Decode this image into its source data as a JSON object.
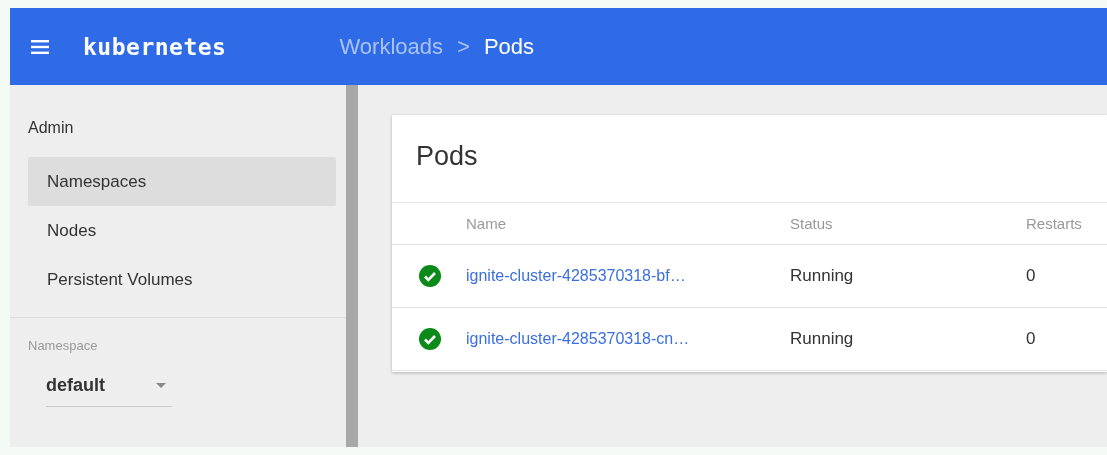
{
  "top_bar": {
    "logo": "kubernetes",
    "breadcrumb": [
      {
        "label": "Workloads"
      },
      {
        "label": "Pods"
      }
    ],
    "separator": ">"
  },
  "sidebar": {
    "section": "Admin",
    "items": [
      {
        "label": "Namespaces",
        "selected": true
      },
      {
        "label": "Nodes",
        "selected": false
      },
      {
        "label": "Persistent Volumes",
        "selected": false
      }
    ],
    "namespace": {
      "label": "Namespace",
      "value": "default"
    }
  },
  "card": {
    "title": "Pods",
    "columns": [
      "Name",
      "Status",
      "Restarts"
    ],
    "rows": [
      {
        "kind": "healthy",
        "name": "ignite-cluster-4285370318-bf…",
        "phase": "Running",
        "restarts": "0"
      },
      {
        "kind": "healthy",
        "name": "ignite-cluster-4285370318-cn…",
        "phase": "Running",
        "restarts": "0"
      }
    ]
  }
}
